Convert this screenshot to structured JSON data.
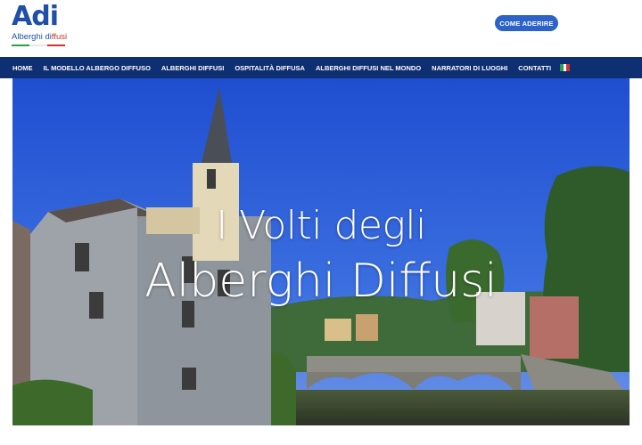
{
  "brand": {
    "logo_text": "Adi",
    "subtitle_main": "Alberghi di",
    "subtitle_highlight": "ffusi",
    "flag_colors": [
      "#2e9e4b",
      "#ffffff",
      "#d2322d"
    ]
  },
  "header": {
    "cta_label": "COME ADERIRE",
    "accent_color": "#2d63c8"
  },
  "nav": {
    "items": [
      {
        "label": "HOME"
      },
      {
        "label": "IL MODELLO ALBERGO DIFFUSO"
      },
      {
        "label": "ALBERGHI DIFFUSI"
      },
      {
        "label": "OSPITALITÀ DIFFUSA"
      },
      {
        "label": "ALBERGHI DIFFUSI NEL MONDO"
      },
      {
        "label": "NARRATORI DI LUOGHI"
      },
      {
        "label": "CONTATTI"
      }
    ],
    "language_icon": "italian-flag-icon",
    "background_color": "#0f2f73"
  },
  "hero": {
    "title_line1": "I Volti degli",
    "title_line2": "Alberghi Diffusi",
    "image_icon": "village-bridge-photo"
  }
}
